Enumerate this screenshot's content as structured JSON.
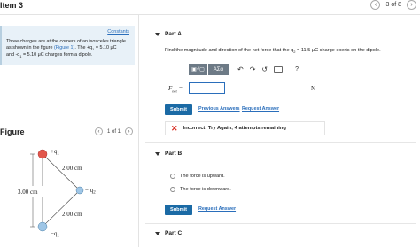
{
  "header": {
    "item_title": "Item 3",
    "pager_text": "3 of 8",
    "prev_icon": "chevron-left-icon",
    "next_icon": "chevron-right-icon"
  },
  "intro": {
    "constants_link": "Constants",
    "line1": "Three charges are at the corners of an isosceles triangle",
    "line2a": "as shown in the figure ",
    "line2_link": "(Figure 1)",
    "line2b": ". The +q",
    "line2c": " = 5.10 μC",
    "line3a": "and -q",
    "line3b": " = 5.10 μC charges form a dipole.",
    "sub1": "1"
  },
  "figure": {
    "label": "Figure",
    "counter": "1 of 1",
    "charge_top": "+q",
    "charge_top_sub": "1",
    "charge_right": "− q",
    "charge_right_sub": "2",
    "charge_bottom": "−q",
    "charge_bottom_sub": "1",
    "dist_upper": "2.00 cm",
    "dist_lower": "2.00 cm",
    "dist_vertical": "3.00 cm"
  },
  "partA": {
    "label": "Part A",
    "question_a": "Find the magnitude and direction of the net force that the q",
    "question_sub": "2",
    "question_b": " = 11.5 μC charge exerts on the dipole.",
    "toolbar": {
      "templates_label": "▣√▢",
      "greek_label": "AΣφ",
      "undo_icon": "undo-icon",
      "redo_icon": "redo-icon",
      "reset_icon": "reset-icon",
      "keyboard_icon": "keyboard-icon",
      "help_label": "?"
    },
    "var_label": "F",
    "var_sub": "net",
    "var_eq": " =",
    "unit": "N",
    "submit_label": "Submit",
    "prev_answers_label": "Previous Answers",
    "request_answer_label": "Request Answer",
    "feedback_text": "Incorrect; Try Again; 4 attempts remaining"
  },
  "partB": {
    "label": "Part B",
    "option1": "The force is upward.",
    "option2": "The force is downward.",
    "submit_label": "Submit",
    "request_answer_label": "Request Answer"
  },
  "partC": {
    "label": "Part C"
  },
  "colors": {
    "accent": "#1b6aa5",
    "link": "#2a6ebb",
    "error": "#d93025",
    "intro_bg": "#e8f1f8",
    "toolbar_dark": "#6d7a86",
    "positive_charge": "#e2574c",
    "negative_charge": "#9fc6e6"
  }
}
